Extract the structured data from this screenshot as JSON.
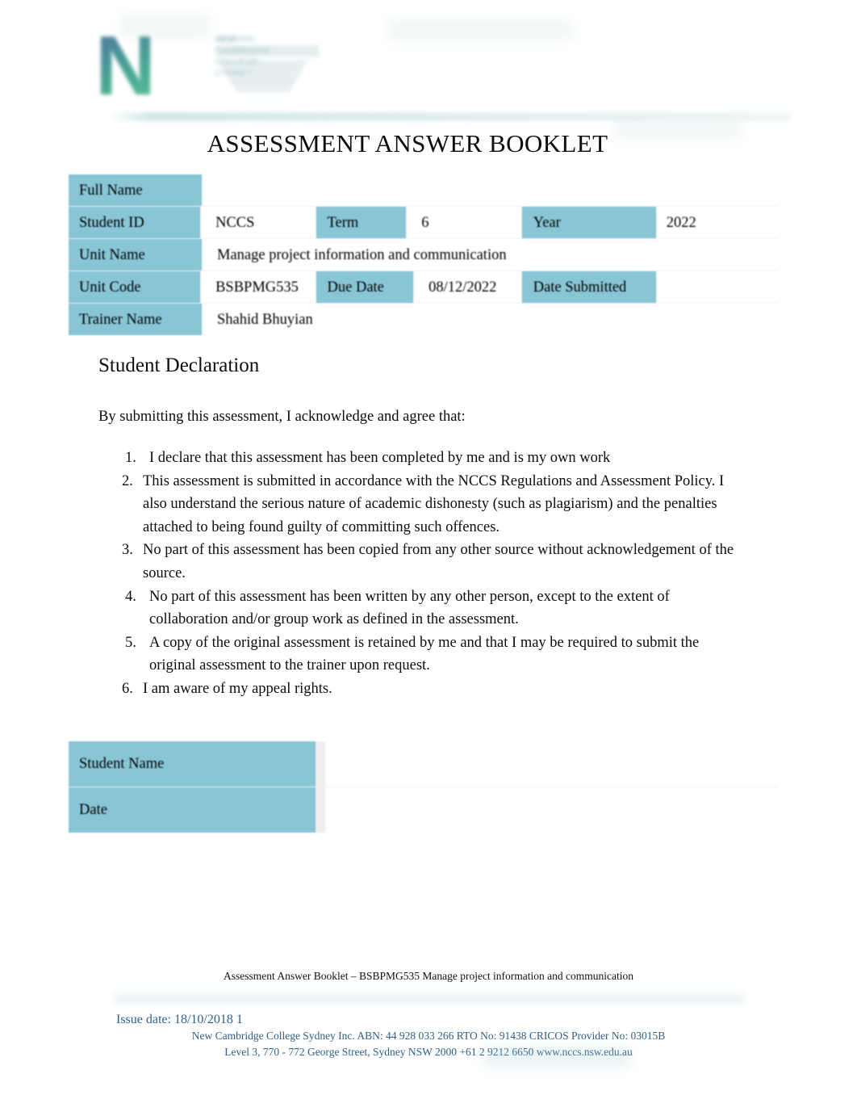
{
  "document": {
    "title": "ASSESSMENT ANSWER BOOKLET",
    "logo": {
      "letter": "N",
      "wordmark": "NEW\nCAMBRIDGE\nCOLLEGE\nSYDNEY"
    }
  },
  "info_table": {
    "rows": [
      {
        "label": "Full Name",
        "value": ""
      },
      {
        "label": "Student ID",
        "value": "NCCS",
        "mid_label": "Term",
        "mid_value": "6",
        "right_label": "Year",
        "right_value": "2022"
      },
      {
        "label": "Unit Name",
        "value": "Manage project information and communication"
      },
      {
        "label": "Unit Code",
        "value": "BSBPMG535",
        "mid_label": "Due Date",
        "mid_value": "08/12/2022",
        "right_label": "Date Submitted",
        "right_value": ""
      },
      {
        "label": "Trainer Name",
        "value": "Shahid Bhuyian"
      }
    ]
  },
  "declaration": {
    "heading": "Student Declaration",
    "intro": "By submitting this assessment, I acknowledge and agree that:",
    "items": [
      {
        "num": "1.",
        "text": "I declare that this assessment has been completed by me and is my own work",
        "indent": "a"
      },
      {
        "num": "2.",
        "text": "This assessment is submitted in accordance with the NCCS Regulations and Assessment Policy. I also understand the serious nature of academic dishonesty (such as plagiarism) and the penalties attached to being found guilty of committing such offences.",
        "indent": "b"
      },
      {
        "num": "3.",
        "text": "No part of this assessment has been copied from any other source without acknowledgement of the source.",
        "indent": "b"
      },
      {
        "num": "4.",
        "text": "No part of this assessment has been written by any other person, except to the extent of collaboration and/or group work as defined in the assessment.",
        "indent": "a"
      },
      {
        "num": "5.",
        "text": "A copy of the original assessment is retained by me and that I may be required to submit the original assessment to the trainer upon request.",
        "indent": "a"
      },
      {
        "num": "6.",
        "text": "I am aware of my appeal rights.",
        "indent": "b"
      }
    ]
  },
  "signature_table": {
    "rows": [
      {
        "label": "Student Name",
        "value": ""
      },
      {
        "label": "Date",
        "value": ""
      }
    ]
  },
  "footer": {
    "running_text": "Assessment Answer Booklet – BSBPMG535 Manage project information and communication",
    "issue_date": "Issue date: 18/10/2018 1",
    "address_line_1": "New Cambridge College Sydney Inc. ABN: 44 928 033 266 RTO No: 91438 CRICOS Provider No: 03015B",
    "address_line_2": "Level 3, 770 - 772 George Street, Sydney NSW 2000 +61 2 9212 6650 www.nccs.nsw.edu.au"
  },
  "colors": {
    "label_fill": "#88c6d6",
    "footer_text": "#2f608a",
    "logo_teal": "#3aa289",
    "logo_blue": "#3d6f90"
  }
}
